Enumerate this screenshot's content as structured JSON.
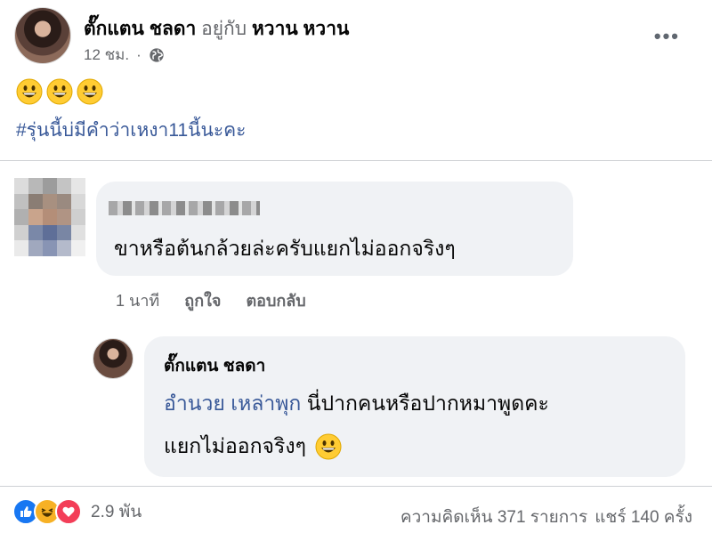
{
  "post": {
    "author": "ตั๊กแตน ชลดา",
    "with_text": "อยู่กับ",
    "tagged": "หวาน หวาน",
    "time": "12 ชม.",
    "separator": "·",
    "privacy_icon": "globe-icon",
    "more_icon": "more-options-icon",
    "more_label": "•••",
    "emojis": [
      "grinning-face",
      "grinning-face",
      "grinning-face"
    ],
    "hashtag": "#รุ่นนี้บ่มีคำว่าเหงา11นี้นะคะ"
  },
  "comment": {
    "text": "ขาหรือต้นกล้วยล่ะครับแยกไม่ออกจริงๆ",
    "time": "1 นาที",
    "like_label": "ถูกใจ",
    "reply_label": "ตอบกลับ"
  },
  "reply": {
    "author": "ตั๊กแตน ชลดา",
    "mention": "อำนวย เหล่าพุก",
    "line1_text": "นี่ปากคนหรือปากหมาพูดคะ",
    "line2_text": "แยกไม่ออกจริงๆ",
    "emoji": "grinning-face"
  },
  "footer": {
    "reactions": [
      "like",
      "haha",
      "love"
    ],
    "reaction_count": "2.9 พัน",
    "comments": "ความคิดเห็น 371 รายการ",
    "shares": "แชร์ 140 ครั้ง"
  },
  "colors": {
    "link": "#385898",
    "muted": "#65676b",
    "bubble": "#f0f2f5",
    "like": "#1877f2",
    "haha": "#f7b125",
    "love": "#f33e58"
  }
}
